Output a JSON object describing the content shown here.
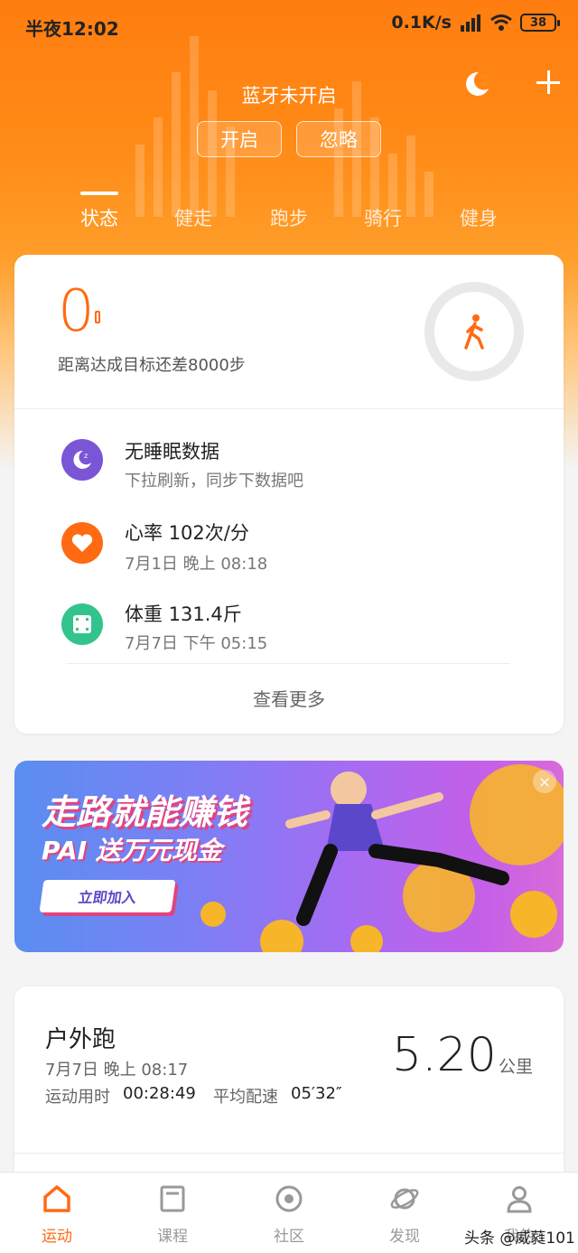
{
  "statusbar": {
    "time": "半夜12:02",
    "speed": "0.1K/s",
    "battery": "38"
  },
  "bluetooth": {
    "title": "蓝牙未开启",
    "enable_label": "开启",
    "ignore_label": "忽略"
  },
  "tabs": [
    {
      "label": "状态"
    },
    {
      "label": "健走"
    },
    {
      "label": "跑步"
    },
    {
      "label": "骑行"
    },
    {
      "label": "健身"
    }
  ],
  "steps": {
    "count": "0",
    "subtitle": "距离达成目标还差8000步"
  },
  "rows": [
    {
      "title": "无睡眠数据",
      "sub": "下拉刷新，同步下数据吧"
    },
    {
      "title": "心率  102次/分",
      "sub": "7月1日  晚上  08:18"
    },
    {
      "title": "体重  131.4斤",
      "sub": "7月7日  下午  05:15"
    }
  ],
  "more_label": "查看更多",
  "banner": {
    "line1": "走路就能赚钱",
    "line2": "PAI 送万元现金",
    "button": "立即加入",
    "close": "×"
  },
  "run": {
    "title": "户外跑",
    "date": "7月7日 晚上 08:17",
    "duration_label": "运动用时",
    "duration": "00:28:49",
    "pace_label": "平均配速",
    "pace": "05′32″",
    "distance": "5.20",
    "unit": "公里"
  },
  "nav": [
    {
      "label": "运动"
    },
    {
      "label": "课程"
    },
    {
      "label": "社区"
    },
    {
      "label": "发现"
    },
    {
      "label": "我的"
    }
  ],
  "watermark": "头条 @威蕤101",
  "colors": {
    "accent": "#ff6a12",
    "sleep": "#7a55d6",
    "heart": "#ff6a12",
    "weight": "#33c48d"
  }
}
